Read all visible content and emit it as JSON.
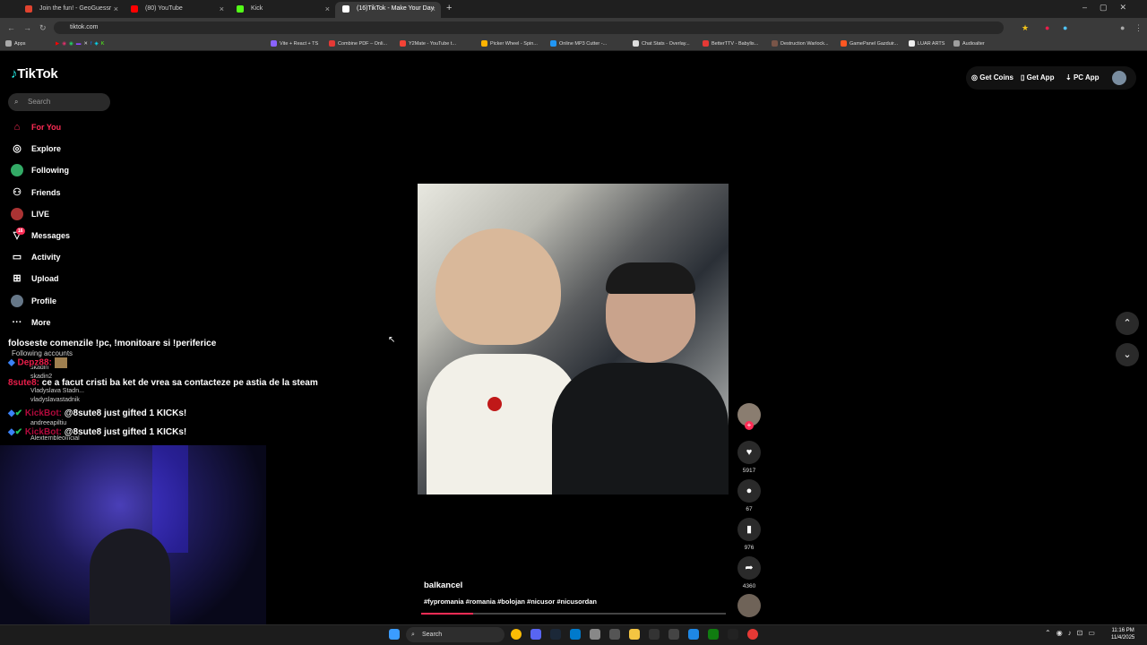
{
  "browser": {
    "tabs": [
      {
        "title": "Join the fun! - GeoGuessr",
        "color": "#e0432f"
      },
      {
        "title": "(80) YouTube",
        "color": "#ff0000"
      },
      {
        "title": "Kick",
        "color": "#53fc18"
      },
      {
        "title": "(16)TikTok - Make Your Day",
        "color": "#ffffff"
      }
    ],
    "new_tab": "+",
    "url": "tiktok.com",
    "bookmarks": [
      {
        "label": "Apps"
      },
      {
        "label": "Vite + React + TS"
      },
      {
        "label": "Combine PDF – Onli..."
      },
      {
        "label": "Y2Mate - YouTube t..."
      },
      {
        "label": "Picker Wheel - Spin..."
      },
      {
        "label": "Online MP3 Cutter -..."
      },
      {
        "label": "Chat Stats - Overlay..."
      },
      {
        "label": "BetterTTV - Babylis..."
      },
      {
        "label": "Destruction Warlock..."
      },
      {
        "label": "GamePanel Gazduir..."
      },
      {
        "label": "LUAR ARTS"
      },
      {
        "label": "Audioalter"
      }
    ]
  },
  "tiktok": {
    "logo": "TikTok",
    "search_placeholder": "Search",
    "nav": [
      {
        "label": "For You",
        "icon": "home-icon"
      },
      {
        "label": "Explore",
        "icon": "compass-icon"
      },
      {
        "label": "Following",
        "icon": "following-avatar-icon"
      },
      {
        "label": "Friends",
        "icon": "friends-icon"
      },
      {
        "label": "LIVE",
        "icon": "live-icon"
      },
      {
        "label": "Messages",
        "icon": "messages-icon",
        "badge": "16"
      },
      {
        "label": "Activity",
        "icon": "activity-icon"
      },
      {
        "label": "Upload",
        "icon": "upload-icon"
      },
      {
        "label": "Profile",
        "icon": "profile-icon"
      },
      {
        "label": "More",
        "icon": "more-icon"
      }
    ],
    "following_accounts_header": "Following accounts",
    "following_accounts": [
      "skadin",
      "skadin2",
      "Vladyslava Stadn...",
      "vladyslavastadnik",
      "andreeapiltiu",
      "Alexterribleofficial"
    ],
    "top_actions": {
      "get_coins": "Get Coins",
      "get_app": "Get App",
      "pc_app": "PC App"
    },
    "video": {
      "author": "balkancel",
      "hashtags": "#fypromania #romania #bolojan #nicusor #nicusordan",
      "progress": 0.17,
      "likes": "5917",
      "comments": "67",
      "saves": "976",
      "shares": "4360"
    }
  },
  "chat_overlay": [
    {
      "user": "",
      "text": "foloseste comenzile !pc, !monitoare si !periferice"
    },
    {
      "user": "Depz88:",
      "text": ""
    },
    {
      "user": "8sute8:",
      "text": "ce a facut cristi ba ket de vrea sa contacteze pe astia de la steam"
    },
    {
      "user": "KickBot:",
      "text": "@8sute8 just gifted 1 KICKs!"
    },
    {
      "user": "KickBot:",
      "text": "@8sute8 just gifted 1 KICKs!"
    }
  ],
  "taskbar": {
    "search": "Search",
    "time": "11:16 PM",
    "date": "11/4/2025"
  }
}
